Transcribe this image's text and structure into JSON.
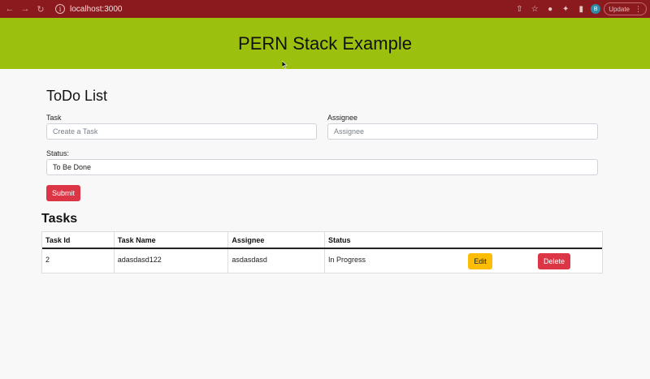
{
  "browser": {
    "url": "localhost:3000",
    "update_label": "Update",
    "profile_initial": "B"
  },
  "header": {
    "title": "PERN Stack Example",
    "color": "#9bc00e"
  },
  "form": {
    "title": "ToDo List",
    "task_label": "Task",
    "task_placeholder": "Create a Task",
    "assignee_label": "Assignee",
    "assignee_placeholder": "Assignee",
    "status_label": "Status:",
    "status_value": "To Be Done",
    "submit_label": "Submit"
  },
  "tasks": {
    "title": "Tasks",
    "columns": [
      "Task Id",
      "Task Name",
      "Assignee",
      "Status"
    ],
    "rows": [
      {
        "id": "2",
        "name": "adasdasd122",
        "assignee": "asdasdasd",
        "status": "In Progress",
        "edit_label": "Edit",
        "delete_label": "Delete"
      }
    ]
  },
  "colors": {
    "danger": "#dc3545",
    "warning": "#fbbd06",
    "chrome": "#8a1a1d"
  }
}
